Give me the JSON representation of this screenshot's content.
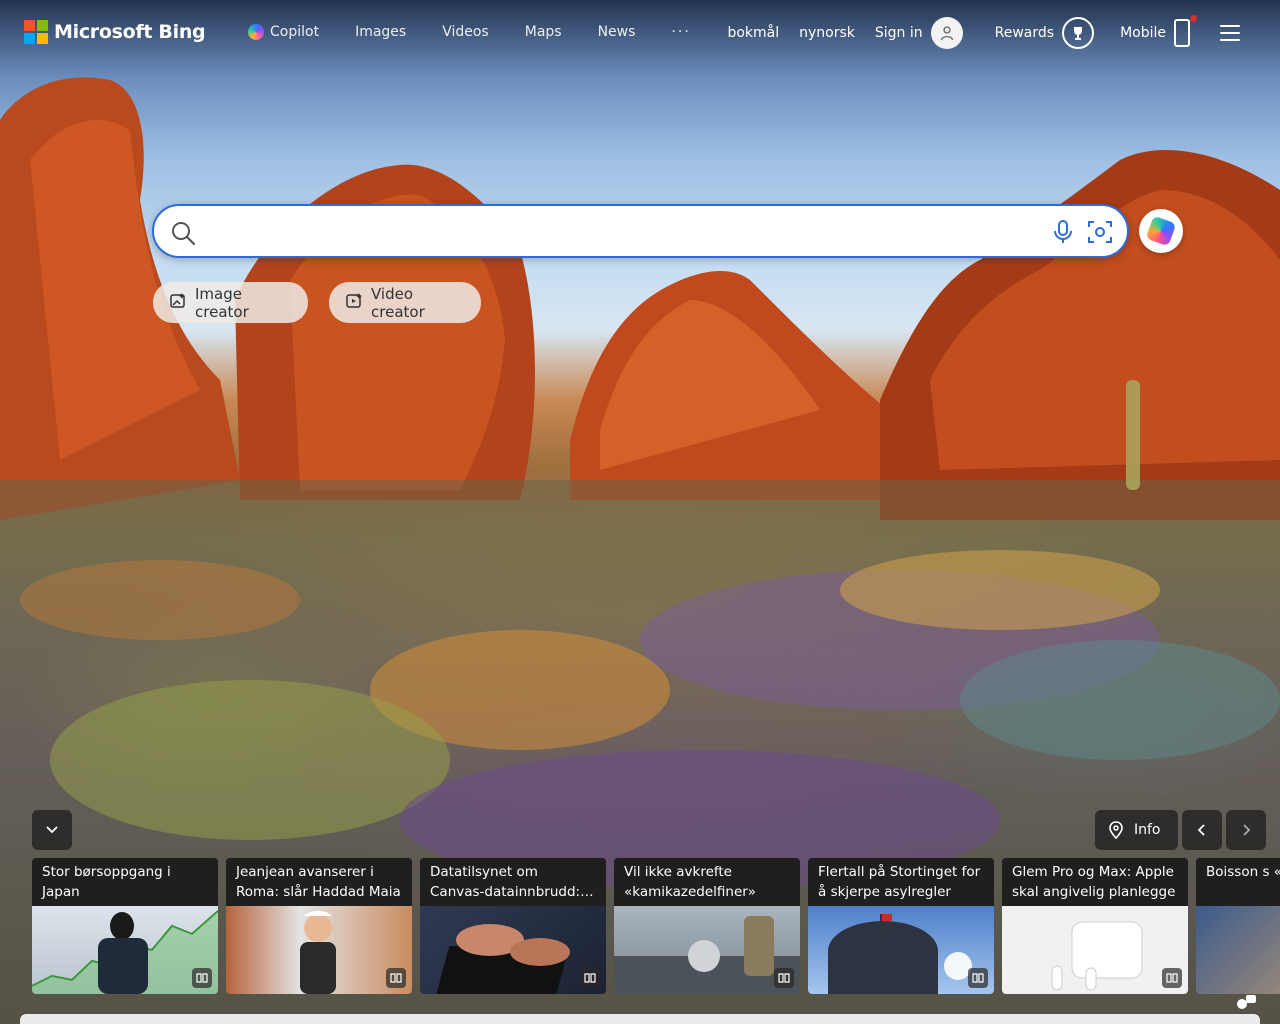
{
  "header": {
    "brand": "Microsoft Bing",
    "nav": [
      "Copilot",
      "Images",
      "Videos",
      "Maps",
      "News"
    ],
    "more": "···",
    "lang_1": "bokmål",
    "lang_2": "nynorsk",
    "sign_in": "Sign in",
    "rewards": "Rewards",
    "mobile": "Mobile"
  },
  "search": {
    "value": "",
    "placeholder": ""
  },
  "chips": {
    "image_creator": "Image creator",
    "video_creator": "Video creator"
  },
  "bottom": {
    "info": "Info"
  },
  "news": [
    {
      "title": "Stor børsoppgang i Japan"
    },
    {
      "title": "Jeanjean avanserer i Roma: slår Haddad Maia"
    },
    {
      "title": "Datatilsynet om Canvas-datainnbrudd: – Fremstilles"
    },
    {
      "title": "Vil ikke avkrefte «kamikazedelfiner»"
    },
    {
      "title": "Flertall på Stortinget for å skjerpe asylregler"
    },
    {
      "title": "Glem Pro og Max: Apple skal angivelig planlegge"
    },
    {
      "title": "Boisson s «Ingentin"
    }
  ],
  "colors": {
    "accent": "#2f6bd8",
    "ms_red": "#f35325",
    "ms_green": "#81bc06",
    "ms_blue": "#05a6f0",
    "ms_yellow": "#ffba08"
  }
}
